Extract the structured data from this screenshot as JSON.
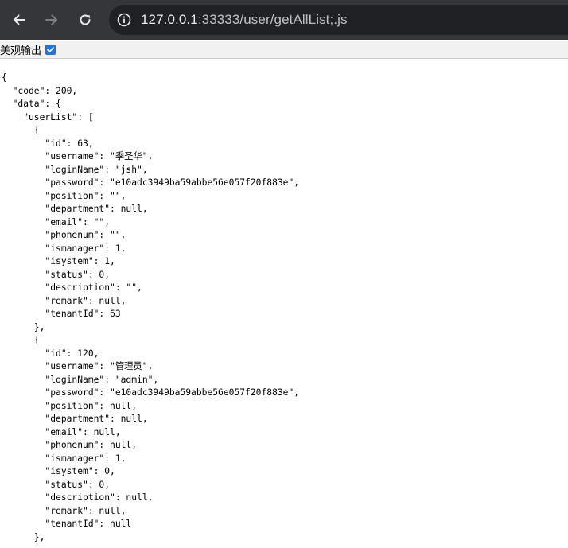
{
  "browser": {
    "url_host": "127.0.0.1",
    "url_path": ":33333/user/getAllList;.js",
    "icons": [
      "back-arrow-icon",
      "forward-arrow-icon",
      "reload-icon",
      "site-info-icon"
    ],
    "colors": {
      "toolbar": "#35363a",
      "omnibox": "#202124",
      "url_host": "#e8eaed",
      "url_path": "#bdc1c6"
    }
  },
  "pretty_print": {
    "label": "美观输出",
    "checked": true,
    "checkbox_color": "#1a73e8"
  },
  "json_lines": [
    "{",
    "  \"code\": 200,",
    "  \"data\": {",
    "    \"userList\": [",
    "      {",
    "        \"id\": 63,",
    "        \"username\": \"季圣华\",",
    "        \"loginName\": \"jsh\",",
    "        \"password\": \"e10adc3949ba59abbe56e057f20f883e\",",
    "        \"position\": \"\",",
    "        \"department\": null,",
    "        \"email\": \"\",",
    "        \"phonenum\": \"\",",
    "        \"ismanager\": 1,",
    "        \"isystem\": 1,",
    "        \"status\": 0,",
    "        \"description\": \"\",",
    "        \"remark\": null,",
    "        \"tenantId\": 63",
    "      },",
    "      {",
    "        \"id\": 120,",
    "        \"username\": \"管理员\",",
    "        \"loginName\": \"admin\",",
    "        \"password\": \"e10adc3949ba59abbe56e057f20f883e\",",
    "        \"position\": null,",
    "        \"department\": null,",
    "        \"email\": null,",
    "        \"phonenum\": null,",
    "        \"ismanager\": 1,",
    "        \"isystem\": 0,",
    "        \"status\": 0,",
    "        \"description\": null,",
    "        \"remark\": null,",
    "        \"tenantId\": null",
    "      },"
  ]
}
